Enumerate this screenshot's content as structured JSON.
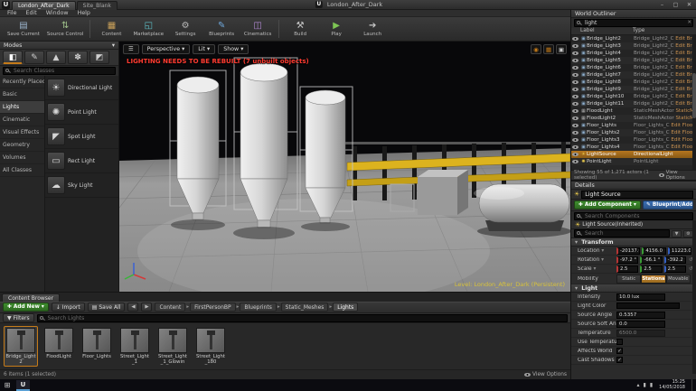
{
  "colors": {
    "accent-orange": "#c57b19",
    "btn-green": "#3f8f2f",
    "btn-blue": "#3a6fb5",
    "warning-red": "#ff3b30",
    "level-yellow": "#d8c23a",
    "selection-orange": "#b5761f",
    "edit-link": "#c89050",
    "barrier-yellow": "#dcb31e"
  },
  "icons": {
    "hamburger": "☰",
    "dropdown": "▾",
    "close": "✕",
    "minimize": "–",
    "maximize": "▢",
    "back": "◀",
    "forward": "▶",
    "breadcrumb_sep": "▸",
    "check": "✓",
    "clear": "✕",
    "caret_up": "▴",
    "reset": "↺",
    "plus": "✚",
    "import_arrow": "↓",
    "save_disk": "▤",
    "filter": "▼",
    "gear": "⚙",
    "camera": "◉",
    "grid": "▦",
    "max_vp": "▣",
    "ue_logo": "U",
    "start": "⊞",
    "pencil": "✎",
    "sun": "☀",
    "tray_generic": "▮"
  },
  "titlebar": {
    "tabs": [
      {
        "label": "London_After_Dark",
        "active": true
      },
      {
        "label": "Site_Blank",
        "active": false
      }
    ],
    "title": "London_After_Dark"
  },
  "menubar": {
    "items": [
      "File",
      "Edit",
      "Window",
      "Help"
    ]
  },
  "toolbar": {
    "buttons": [
      {
        "label": "Save Current",
        "icon": "save-icon"
      },
      {
        "label": "Source Control",
        "icon": "source-control-icon"
      },
      {
        "label": "Content",
        "icon": "content-icon"
      },
      {
        "label": "Marketplace",
        "icon": "marketplace-icon"
      },
      {
        "label": "Settings",
        "icon": "settings-icon"
      },
      {
        "label": "Blueprints",
        "icon": "blueprints-icon"
      },
      {
        "label": "Cinematics",
        "icon": "cinematics-icon"
      },
      {
        "label": "Build",
        "icon": "build-icon"
      },
      {
        "label": "Play",
        "icon": "play-icon"
      },
      {
        "label": "Launch",
        "icon": "launch-icon"
      }
    ]
  },
  "modes": {
    "title": "Modes",
    "tools": [
      "place-mode-icon",
      "paint-mode-icon",
      "landscape-mode-icon",
      "foliage-mode-icon",
      "geometry-mode-icon"
    ],
    "search_placeholder": "Search Classes",
    "categories": [
      "Recently Placed",
      "Basic",
      "Lights",
      "Cinematic",
      "Visual Effects",
      "Geometry",
      "Volumes",
      "All Classes"
    ],
    "active_category": "Lights",
    "items": [
      {
        "label": "Directional Light",
        "icon": "directional-light-icon"
      },
      {
        "label": "Point Light",
        "icon": "point-light-icon"
      },
      {
        "label": "Spot Light",
        "icon": "spot-light-icon"
      },
      {
        "label": "Rect Light",
        "icon": "rect-light-icon"
      },
      {
        "label": "Sky Light",
        "icon": "sky-light-icon"
      }
    ]
  },
  "viewport": {
    "buttons": {
      "perspective": "Perspective",
      "lit": "Lit",
      "show": "Show"
    },
    "warning": "LIGHTING NEEDS TO BE REBUILT (7 unbuilt objects)",
    "level_label": "Level: London_After_Dark (Persistent)"
  },
  "outliner": {
    "title": "World Outliner",
    "search_value": "light",
    "columns": [
      "Label",
      "Type"
    ],
    "rows": [
      {
        "label": "Bridge_Light2",
        "type": "Bridge_Light2_C",
        "edit": "Edit Bridge_Li",
        "icon": "blueprint-actor-icon",
        "selected": false
      },
      {
        "label": "Bridge_Light3",
        "type": "Bridge_Light2_C",
        "edit": "Edit Bridge_Li",
        "icon": "blueprint-actor-icon",
        "selected": false
      },
      {
        "label": "Bridge_Light4",
        "type": "Bridge_Light2_C",
        "edit": "Edit Bridge_Li",
        "icon": "blueprint-actor-icon",
        "selected": false
      },
      {
        "label": "Bridge_Light5",
        "type": "Bridge_Light2_C",
        "edit": "Edit Bridge_Li",
        "icon": "blueprint-actor-icon",
        "selected": false
      },
      {
        "label": "Bridge_Light6",
        "type": "Bridge_Light2_C",
        "edit": "Edit Bridge_Li",
        "icon": "blueprint-actor-icon",
        "selected": false
      },
      {
        "label": "Bridge_Light7",
        "type": "Bridge_Light2_C",
        "edit": "Edit Bridge_Li",
        "icon": "blueprint-actor-icon",
        "selected": false
      },
      {
        "label": "Bridge_Light8",
        "type": "Bridge_Light2_C",
        "edit": "Edit Bridge_Li",
        "icon": "blueprint-actor-icon",
        "selected": false
      },
      {
        "label": "Bridge_Light9",
        "type": "Bridge_Light2_C",
        "edit": "Edit Bridge_Li",
        "icon": "blueprint-actor-icon",
        "selected": false
      },
      {
        "label": "Bridge_Light10",
        "type": "Bridge_Light2_C",
        "edit": "Edit Bridge_Li",
        "icon": "blueprint-actor-icon",
        "selected": false
      },
      {
        "label": "Bridge_Light11",
        "type": "Bridge_Light2_C",
        "edit": "Edit Bridge_Li",
        "icon": "blueprint-actor-icon",
        "selected": false
      },
      {
        "label": "FloodLight",
        "type": "StaticMeshActor",
        "edit": "StaticMeshActo",
        "icon": "static-mesh-actor-icon",
        "selected": false
      },
      {
        "label": "FloodLight2",
        "type": "StaticMeshActor",
        "edit": "StaticMeshActo",
        "icon": "static-mesh-actor-icon",
        "selected": false
      },
      {
        "label": "Floor_Lights",
        "type": "Floor_Lights_C",
        "edit": "Edit Floor_Lig",
        "icon": "blueprint-actor-icon",
        "selected": false
      },
      {
        "label": "Floor_Lights2",
        "type": "Floor_Lights_C",
        "edit": "Edit Floor_Lig",
        "icon": "blueprint-actor-icon",
        "selected": false
      },
      {
        "label": "Floor_Lights3",
        "type": "Floor_Lights_C",
        "edit": "Edit Floor_Lig",
        "icon": "blueprint-actor-icon",
        "selected": false
      },
      {
        "label": "Floor_Lights4",
        "type": "Floor_Lights_C",
        "edit": "Edit Floor_Lig",
        "icon": "blueprint-actor-icon",
        "selected": false
      },
      {
        "label": "LightSource",
        "type": "DirectionalLight",
        "edit": "",
        "icon": "dirlight-actor-icon",
        "selected": true
      },
      {
        "label": "PointLight",
        "type": "PointLight",
        "edit": "",
        "icon": "pointlight-actor-icon",
        "selected": false
      }
    ],
    "footer": "Showing 55 of 1,271 actors (1 selected)",
    "view_options": "View Options"
  },
  "details": {
    "title": "Details",
    "actor_name": "Light Source",
    "add_component": "Add Component",
    "blueprint_add": "Blueprint/Add Scr",
    "search_components_placeholder": "Search Components",
    "component": "Light Source(Inherited)",
    "search_placeholder": "Search",
    "transform": {
      "header": "Transform",
      "location": {
        "label": "Location",
        "x": "-20137.0",
        "y": "4156.0",
        "z": "11223.0"
      },
      "rotation": {
        "label": "Rotation",
        "x": "-97.2 °",
        "y": "-66.1 °",
        "z": "-392.2 °"
      },
      "scale": {
        "label": "Scale",
        "x": "2.5",
        "y": "2.5",
        "z": "2.5"
      },
      "mobility": {
        "label": "Mobility",
        "options": [
          "Static",
          "Stationary",
          "Movable"
        ],
        "active": "Stationary"
      }
    },
    "light": {
      "header": "Light",
      "rows": [
        {
          "label": "Intensity",
          "value": "10.0 lux",
          "kind": "input"
        },
        {
          "label": "Light Color",
          "value": "#101010",
          "kind": "color"
        },
        {
          "label": "Source Angle",
          "value": "0.5357",
          "kind": "input"
        },
        {
          "label": "Source Soft Angle",
          "value": "0.0",
          "kind": "input"
        },
        {
          "label": "Temperature",
          "value": "6500.0",
          "kind": "input-disabled"
        },
        {
          "label": "Use Temperature",
          "value": false,
          "kind": "checkbox"
        },
        {
          "label": "Affects World",
          "value": true,
          "kind": "checkbox"
        },
        {
          "label": "Cast Shadows",
          "value": true,
          "kind": "checkbox"
        }
      ]
    }
  },
  "content_browser": {
    "tab": "Content Browser",
    "add_new": "Add New",
    "import": "Import",
    "save_all": "Save All",
    "breadcrumb": [
      "Content",
      "FirstPersonBP",
      "Blueprints",
      "Static_Meshes",
      "Lights"
    ],
    "filters": "Filters",
    "search_placeholder": "Search Lights",
    "assets": [
      {
        "name": "Bridge_Light2",
        "selected": true
      },
      {
        "name": "FloodLight",
        "selected": false
      },
      {
        "name": "Floor_Lights",
        "selected": false
      },
      {
        "name": "Street_Light_1",
        "selected": false
      },
      {
        "name": "Street_Light_1_Glowin",
        "selected": false
      },
      {
        "name": "Street_Light_180",
        "selected": false
      }
    ],
    "footer": "6 items (1 selected)",
    "view_options": "View Options"
  },
  "taskbar": {
    "time": "15:25",
    "date": "14/05/2018"
  }
}
